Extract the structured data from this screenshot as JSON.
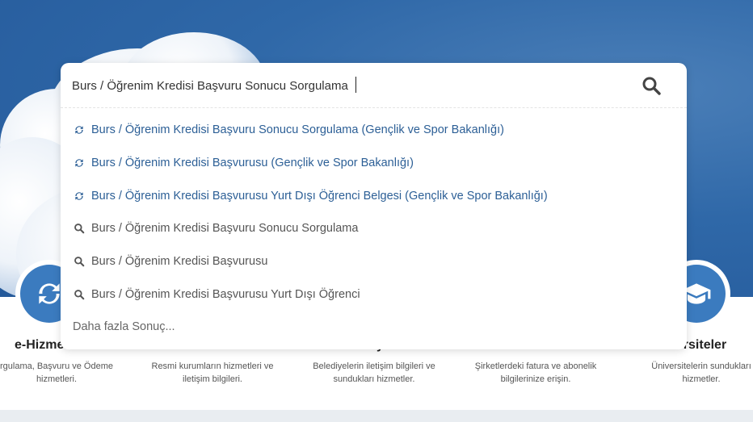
{
  "search": {
    "value": "Burs / Öğrenim Kredisi Başvuru Sonucu Sorgulama",
    "button_icon": "search-icon"
  },
  "suggestions": [
    {
      "type": "service",
      "icon": "refresh-icon",
      "label": "Burs / Öğrenim Kredisi Başvuru Sonucu Sorgulama (Gençlik ve Spor Bakanlığı)"
    },
    {
      "type": "service",
      "icon": "refresh-icon",
      "label": "Burs / Öğrenim Kredisi Başvurusu (Gençlik ve Spor Bakanlığı)"
    },
    {
      "type": "service",
      "icon": "refresh-icon",
      "label": "Burs / Öğrenim Kredisi Başvurusu Yurt Dışı Öğrenci Belgesi (Gençlik ve Spor Bakanlığı)"
    },
    {
      "type": "query",
      "icon": "search-icon",
      "label": "Burs / Öğrenim Kredisi Başvuru Sonucu Sorgulama"
    },
    {
      "type": "query",
      "icon": "search-icon",
      "label": "Burs / Öğrenim Kredisi Başvurusu"
    },
    {
      "type": "query",
      "icon": "search-icon",
      "label": "Burs / Öğrenim Kredisi Başvurusu Yurt Dışı Öğrenci"
    }
  ],
  "more_results": "Daha fazla Sonuç...",
  "categories": {
    "ehizmetler": {
      "title": "e-Hizmet",
      "desc": "rgulama, Başvuru ve Ödeme hizmetleri."
    },
    "kurumlar": {
      "desc": "Resmi kurumların hizmetleri ve iletişim bilgileri."
    },
    "belediyeler": {
      "title_fragment": "y",
      "desc": "Belediyelerin iletişim bilgileri ve sundukları hizmetler."
    },
    "firmalar": {
      "desc": "Şirketlerdeki fatura ve abonelik bilgilerinize erişin."
    },
    "universiteler": {
      "title": "versiteler",
      "desc": "Üniversitelerin sundukları hizmetler."
    }
  },
  "colors": {
    "accent": "#3b7bbf",
    "link": "#2c5f96",
    "hero": "#2f68a8"
  }
}
